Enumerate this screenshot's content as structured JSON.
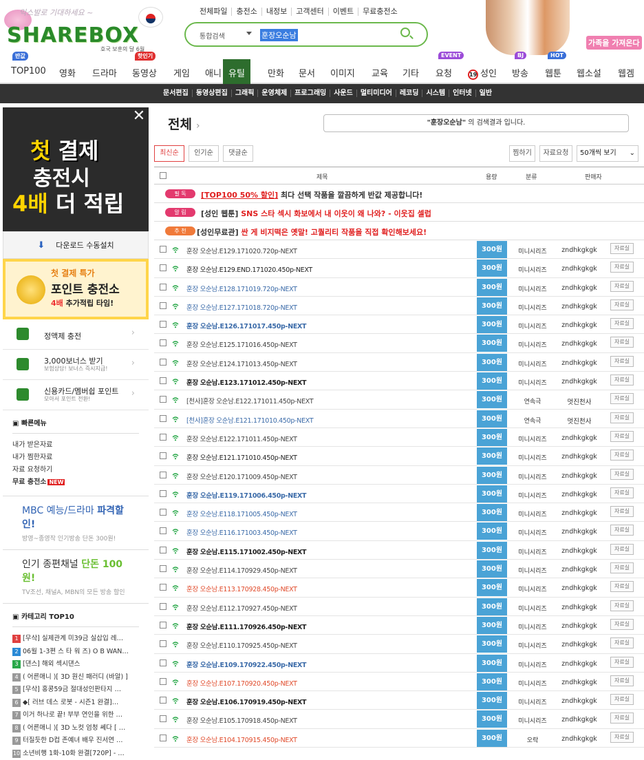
{
  "header": {
    "logo": "SHAREBOX",
    "logo_slogan": "익스발로 기대하세요 ~",
    "logo_sub": "호국 보훈의 달 6월",
    "top_links": [
      "전체파일",
      "충전소",
      "내정보",
      "고객센터",
      "이벤트",
      "무료충전소"
    ],
    "search_select": "통합검색",
    "search_value": "훈장오순남",
    "ad_text": "가족을 가져온다"
  },
  "categories": [
    {
      "label": "TOP100",
      "badge": "반값",
      "badge_color": "#3a6fd8"
    },
    {
      "label": "영화"
    },
    {
      "label": "드라마"
    },
    {
      "label": "동영상",
      "badge": "핫인기",
      "badge_color": "#e03030"
    },
    {
      "label": "게임"
    },
    {
      "label": "애니"
    },
    {
      "label": "유틸",
      "selected": true
    },
    {
      "label": "만화"
    },
    {
      "label": "문서"
    },
    {
      "label": "이미지"
    },
    {
      "label": "교육"
    },
    {
      "label": "기타"
    },
    {
      "label": "요청",
      "badge": "EVENT",
      "badge_color": "#9b4bd8"
    },
    {
      "label": "성인",
      "prefix": "19"
    },
    {
      "label": "방송",
      "badge": "BJ",
      "badge_color": "#9b4bd8"
    },
    {
      "label": "웹툰",
      "badge": "HOT",
      "badge_color": "#3a6fd8"
    },
    {
      "label": "웹소설"
    },
    {
      "label": "웹겜"
    }
  ],
  "subcategories": [
    "문서편집",
    "동영상편집",
    "그래픽",
    "운영체제",
    "프로그래밍",
    "사운드",
    "멀티미디어",
    "레코딩",
    "시스템",
    "인터넷",
    "일반"
  ],
  "sidebar": {
    "banner1": {
      "line1a": "첫",
      "line1b": "결제",
      "line2": "충전시",
      "line3a": "4배",
      "line3b": "더 적립"
    },
    "download": "다운로드 수동설치",
    "point_banner": {
      "a": "첫 결제 특가",
      "b": "포인트 충전소",
      "c1": "4배",
      "c2": " 추가적립 타임!"
    },
    "menu": [
      {
        "title": "정액제 충전",
        "sub": ""
      },
      {
        "title": "3,000보너스 받기",
        "sub": "보험상담! 보너스 즉시지급!"
      },
      {
        "title": "신용카드/멤버쉽 포인트",
        "sub": "모아서 포인트 전환!"
      }
    ],
    "quick_title": "빠른메뉴",
    "quick_items": [
      "내가 받은자료",
      "내가 찜한자료",
      "자료 요청하기",
      "무료 충전소"
    ],
    "quick_new": "NEW",
    "promo1": {
      "a": "MBC 예능/드라마 ",
      "b": "파격할인!",
      "sub": "방영~종영작 인기방송 단돈 300원!"
    },
    "promo2": {
      "a": "인기 종편채널 ",
      "b": "단돈 100원!",
      "sub": "TV조선, 채널A, MBN의 모든 방송 할인"
    },
    "top10_title": "카테고리 TOP10",
    "top10": [
      {
        "rank": "1",
        "text": "[무삭] 실제관계 미39금 실삽입 레…",
        "color": "#e04040"
      },
      {
        "rank": "2",
        "text": "06월 1-3편 스 타 워 즈) O B WAN…",
        "color": "#2a8ad6"
      },
      {
        "rank": "3",
        "text": "[댄스] 해외 섹시댄스",
        "color": "#2aa84a"
      },
      {
        "rank": "4",
        "text": "( 어른애니 )[ 3D 원신 패러디 (바알) ]",
        "color": "#999"
      },
      {
        "rank": "5",
        "text": "[무삭] 홍콩59금 절대성인판타지 …",
        "color": "#999"
      },
      {
        "rank": "6",
        "text": "◆[ 러브 데스 로봇 - 시즌1 완결]…",
        "color": "#999"
      },
      {
        "rank": "7",
        "text": "이거 하나로 끝! 부부 연인을 위한 …",
        "color": "#999"
      },
      {
        "rank": "8",
        "text": "( 어른애니 )[ 3D 노컷 엄청 쎄다 [ …",
        "color": "#999"
      },
      {
        "rank": "9",
        "text": "터질듯한 D컵 존예녀 배우 진서연 …",
        "color": "#999"
      },
      {
        "rank": "10",
        "text": "소년비행 1화-10화 완결[720P] - …",
        "color": "#999"
      }
    ]
  },
  "main": {
    "title": "전체",
    "result_query": "\"훈장오순남\"",
    "result_suffix": " 의 검색결과 입니다.",
    "sort": [
      "최신순",
      "인기순",
      "댓글순"
    ],
    "tools": [
      "찜하기",
      "자료요청"
    ],
    "per_page": "50개씩 보기",
    "columns": {
      "title": "제목",
      "size": "용량",
      "genre": "분류",
      "seller": "판매자"
    },
    "notices": [
      {
        "tag": "필 독",
        "tag_color": "#e33a6e",
        "text_a": "[TOP100 50% 할인]",
        "text_b": " 최다 선택 작품을 깔끔하게 반값 제공합니다!"
      },
      {
        "tag": "알 림",
        "tag_color": "#e33a6e",
        "text_a": "[성인 웹툰]",
        "text_b": " SNS 스타 섹시 화보에서 내 이웃이 왜 나와? - 이웃집 셀럽"
      },
      {
        "tag": "추 천",
        "tag_color": "#f07a3a",
        "text_a": "[성인무료관]",
        "text_b": " 싼 게 비지떡은 옛말! 고퀄리티 작품을 직접 확인해보세요!"
      }
    ],
    "rows": [
      {
        "title": "훈장 오순남.E129.171020.720p-NEXT",
        "style": "normal",
        "price": "300원",
        "genre": "미니시리즈",
        "seller": "zndhkgkgk"
      },
      {
        "title": "훈장 오순남.E129.END.171020.450p-NEXT",
        "style": "dark",
        "price": "300원",
        "genre": "미니시리즈",
        "seller": "zndhkgkgk"
      },
      {
        "title": "훈장 오순남.E128.171019.720p-NEXT",
        "style": "blue",
        "price": "300원",
        "genre": "미니시리즈",
        "seller": "zndhkgkgk"
      },
      {
        "title": "훈장 오순남.E127.171018.720p-NEXT",
        "style": "blue",
        "price": "300원",
        "genre": "미니시리즈",
        "seller": "zndhkgkgk"
      },
      {
        "title": "훈장 오순남.E126.171017.450p-NEXT",
        "style": "bluebold",
        "price": "300원",
        "genre": "미니시리즈",
        "seller": "zndhkgkgk"
      },
      {
        "title": "훈장 오순남.E125.171016.450p-NEXT",
        "style": "normal",
        "price": "300원",
        "genre": "미니시리즈",
        "seller": "zndhkgkgk"
      },
      {
        "title": "훈장 오순남.E124.171013.450p-NEXT",
        "style": "normal",
        "price": "300원",
        "genre": "미니시리즈",
        "seller": "zndhkgkgk"
      },
      {
        "title": "훈장 오순남.E123.171012.450p-NEXT",
        "style": "bold",
        "price": "300원",
        "genre": "미니시리즈",
        "seller": "zndhkgkgk"
      },
      {
        "title": "[천사]훈장 오순남.E122.171011.450p-NEXT",
        "style": "normal",
        "price": "300원",
        "genre": "연속극",
        "seller": "멋진천사"
      },
      {
        "title": "[천사]훈장 오순남.E121.171010.450p-NEXT",
        "style": "blue",
        "price": "300원",
        "genre": "연속극",
        "seller": "멋진천사"
      },
      {
        "title": "훈장 오순남.E122.171011.450p-NEXT",
        "style": "normal",
        "price": "300원",
        "genre": "미니시리즈",
        "seller": "zndhkgkgk"
      },
      {
        "title": "훈장 오순남.E121.171010.450p-NEXT",
        "style": "dark",
        "price": "300원",
        "genre": "미니시리즈",
        "seller": "zndhkgkgk"
      },
      {
        "title": "훈장 오순남.E120.171009.450p-NEXT",
        "style": "normal",
        "price": "300원",
        "genre": "미니시리즈",
        "seller": "zndhkgkgk"
      },
      {
        "title": "훈장 오순남.E119.171006.450p-NEXT",
        "style": "bluebold",
        "price": "300원",
        "genre": "미니시리즈",
        "seller": "zndhkgkgk"
      },
      {
        "title": "훈장 오순남.E118.171005.450p-NEXT",
        "style": "blue",
        "price": "300원",
        "genre": "미니시리즈",
        "seller": "zndhkgkgk"
      },
      {
        "title": "훈장 오순남.E116.171003.450p-NEXT",
        "style": "blue",
        "price": "300원",
        "genre": "미니시리즈",
        "seller": "zndhkgkgk"
      },
      {
        "title": "훈장 오순남.E115.171002.450p-NEXT",
        "style": "bold",
        "price": "300원",
        "genre": "미니시리즈",
        "seller": "zndhkgkgk"
      },
      {
        "title": "훈장 오순남.E114.170929.450p-NEXT",
        "style": "normal",
        "price": "300원",
        "genre": "미니시리즈",
        "seller": "zndhkgkgk"
      },
      {
        "title": "훈장 오순남.E113.170928.450p-NEXT",
        "style": "red",
        "price": "300원",
        "genre": "미니시리즈",
        "seller": "zndhkgkgk"
      },
      {
        "title": "훈장 오순남.E112.170927.450p-NEXT",
        "style": "normal",
        "price": "300원",
        "genre": "미니시리즈",
        "seller": "zndhkgkgk"
      },
      {
        "title": "훈장 오순남.E111.170926.450p-NEXT",
        "style": "bold",
        "price": "300원",
        "genre": "미니시리즈",
        "seller": "zndhkgkgk"
      },
      {
        "title": "훈장 오순남.E110.170925.450p-NEXT",
        "style": "normal",
        "price": "300원",
        "genre": "미니시리즈",
        "seller": "zndhkgkgk"
      },
      {
        "title": "훈장 오순남.E109.170922.450p-NEXT",
        "style": "bluebold",
        "price": "300원",
        "genre": "미니시리즈",
        "seller": "zndhkgkgk"
      },
      {
        "title": "훈장 오순남.E107.170920.450p-NEXT",
        "style": "red",
        "price": "300원",
        "genre": "미니시리즈",
        "seller": "zndhkgkgk"
      },
      {
        "title": "훈장 오순남.E106.170919.450p-NEXT",
        "style": "bold",
        "price": "300원",
        "genre": "미니시리즈",
        "seller": "zndhkgkgk"
      },
      {
        "title": "훈장 오순남.E105.170918.450p-NEXT",
        "style": "normal",
        "price": "300원",
        "genre": "미니시리즈",
        "seller": "zndhkgkgk"
      },
      {
        "title": "훈장 오순남.E104.170915.450p-NEXT",
        "style": "red",
        "price": "300원",
        "genre": "오락",
        "seller": "zndhkgkgk"
      }
    ],
    "row_action": "자료실"
  }
}
